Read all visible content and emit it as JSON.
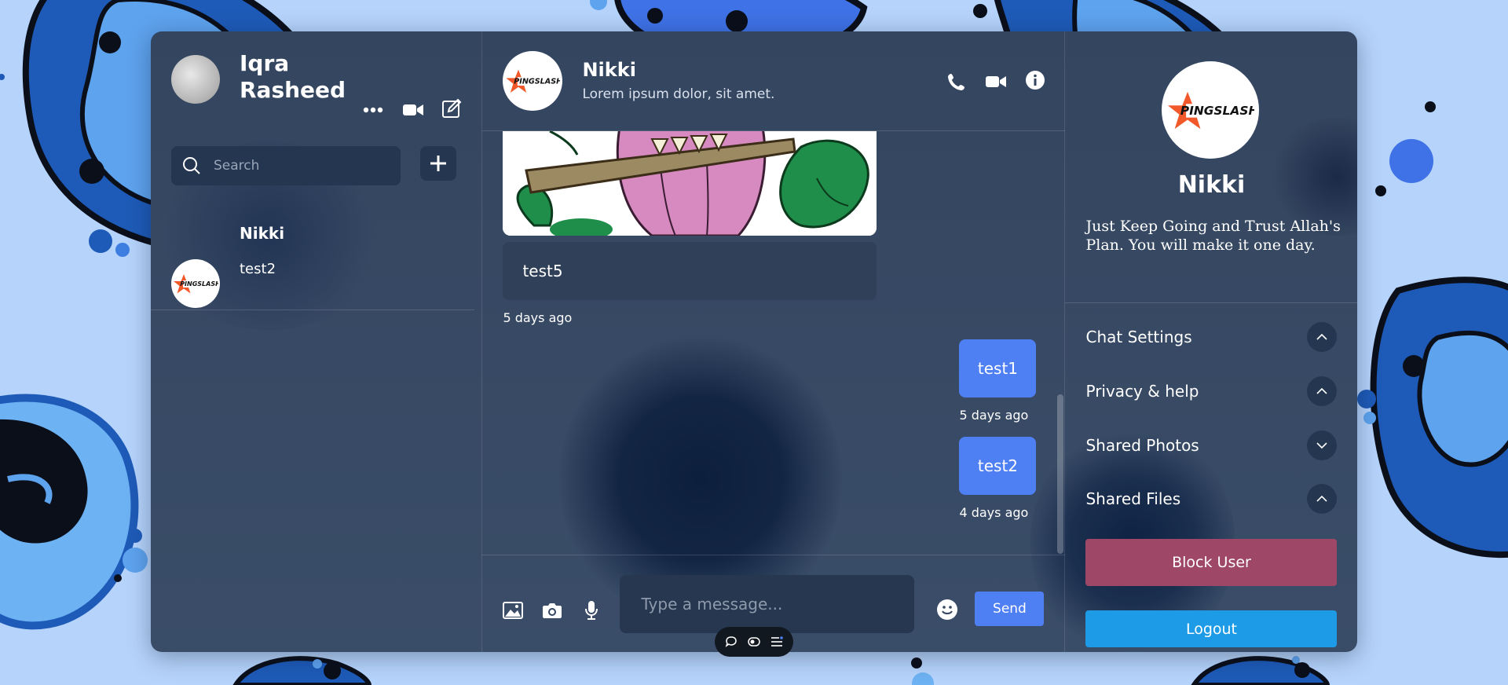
{
  "sidebar": {
    "user_name": "Iqra Rasheed",
    "search_placeholder": "Search",
    "contacts": [
      {
        "name": "Nikki",
        "last_message": "test2"
      }
    ]
  },
  "chat": {
    "peer_name": "Nikki",
    "peer_status": "Lorem ipsum dolor, sit amet.",
    "messages": [
      {
        "text": "test5",
        "time": "5 days ago"
      },
      {
        "text": "test1",
        "time": "5 days ago"
      },
      {
        "text": "test2",
        "time": "4 days ago"
      }
    ],
    "input_placeholder": "Type a message...",
    "send_label": "Send"
  },
  "profile": {
    "name": "Nikki",
    "bio": "Just Keep Going and Trust Allah's Plan. You will make it one day.",
    "sections": [
      {
        "label": "Chat Settings",
        "state": "expanded"
      },
      {
        "label": "Privacy & help",
        "state": "expanded"
      },
      {
        "label": "Shared Photos",
        "state": "collapsed"
      },
      {
        "label": "Shared Files",
        "state": "expanded"
      }
    ],
    "block_label": "Block User",
    "logout_label": "Logout"
  },
  "brand": {
    "logo_text": "PINGSLASH"
  },
  "colors": {
    "accent": "#4e7ff3",
    "block": "#9e4766",
    "logout": "#1e9be6",
    "logo_star": "#f2592a"
  }
}
